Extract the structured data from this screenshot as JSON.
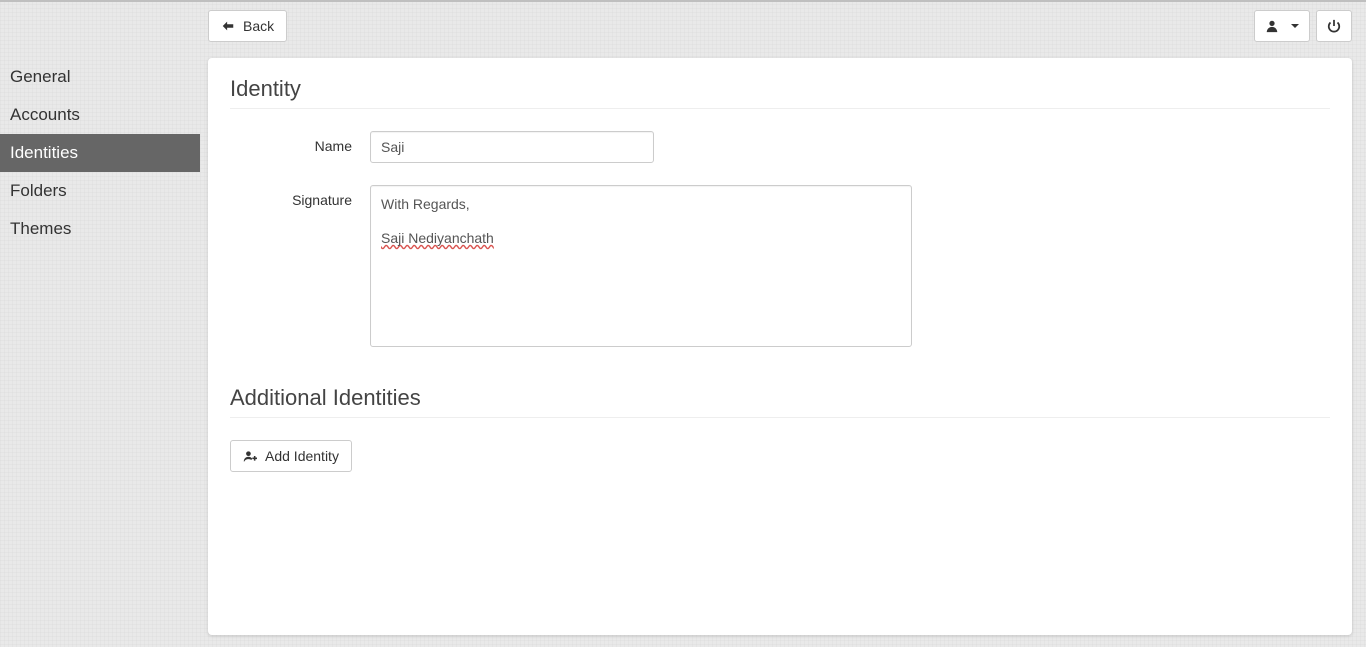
{
  "topbar": {
    "back_label": "Back"
  },
  "sidebar": {
    "items": [
      {
        "label": "General"
      },
      {
        "label": "Accounts"
      },
      {
        "label": "Identities"
      },
      {
        "label": "Folders"
      },
      {
        "label": "Themes"
      }
    ],
    "active_index": 2
  },
  "identity": {
    "section_title": "Identity",
    "name_label": "Name",
    "name_value": "Saji",
    "signature_label": "Signature",
    "signature_line1": "With Regards,",
    "signature_line2": "Saji Nediyanchath"
  },
  "additional": {
    "section_title": "Additional Identities",
    "add_button_label": "Add Identity"
  }
}
